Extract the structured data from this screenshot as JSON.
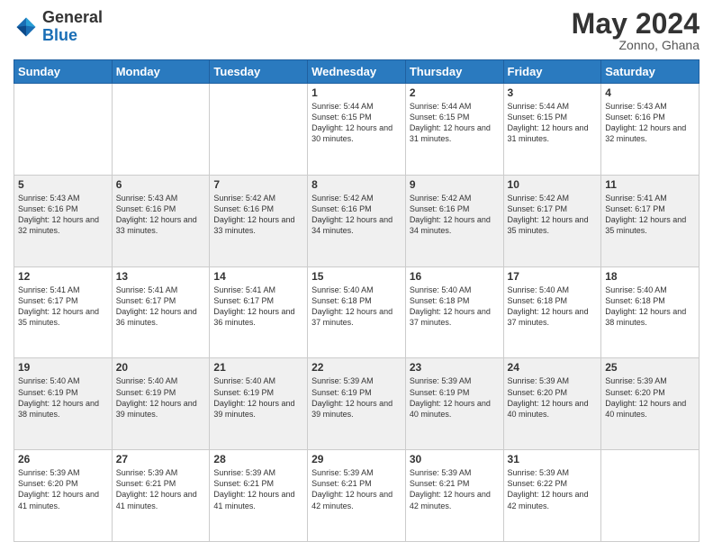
{
  "header": {
    "logo_line1": "General",
    "logo_line2": "Blue",
    "month_year": "May 2024",
    "location": "Zonno, Ghana"
  },
  "days_of_week": [
    "Sunday",
    "Monday",
    "Tuesday",
    "Wednesday",
    "Thursday",
    "Friday",
    "Saturday"
  ],
  "weeks": [
    [
      {
        "day": "",
        "info": ""
      },
      {
        "day": "",
        "info": ""
      },
      {
        "day": "",
        "info": ""
      },
      {
        "day": "1",
        "info": "Sunrise: 5:44 AM\nSunset: 6:15 PM\nDaylight: 12 hours\nand 30 minutes."
      },
      {
        "day": "2",
        "info": "Sunrise: 5:44 AM\nSunset: 6:15 PM\nDaylight: 12 hours\nand 31 minutes."
      },
      {
        "day": "3",
        "info": "Sunrise: 5:44 AM\nSunset: 6:15 PM\nDaylight: 12 hours\nand 31 minutes."
      },
      {
        "day": "4",
        "info": "Sunrise: 5:43 AM\nSunset: 6:16 PM\nDaylight: 12 hours\nand 32 minutes."
      }
    ],
    [
      {
        "day": "5",
        "info": "Sunrise: 5:43 AM\nSunset: 6:16 PM\nDaylight: 12 hours\nand 32 minutes."
      },
      {
        "day": "6",
        "info": "Sunrise: 5:43 AM\nSunset: 6:16 PM\nDaylight: 12 hours\nand 33 minutes."
      },
      {
        "day": "7",
        "info": "Sunrise: 5:42 AM\nSunset: 6:16 PM\nDaylight: 12 hours\nand 33 minutes."
      },
      {
        "day": "8",
        "info": "Sunrise: 5:42 AM\nSunset: 6:16 PM\nDaylight: 12 hours\nand 34 minutes."
      },
      {
        "day": "9",
        "info": "Sunrise: 5:42 AM\nSunset: 6:16 PM\nDaylight: 12 hours\nand 34 minutes."
      },
      {
        "day": "10",
        "info": "Sunrise: 5:42 AM\nSunset: 6:17 PM\nDaylight: 12 hours\nand 35 minutes."
      },
      {
        "day": "11",
        "info": "Sunrise: 5:41 AM\nSunset: 6:17 PM\nDaylight: 12 hours\nand 35 minutes."
      }
    ],
    [
      {
        "day": "12",
        "info": "Sunrise: 5:41 AM\nSunset: 6:17 PM\nDaylight: 12 hours\nand 35 minutes."
      },
      {
        "day": "13",
        "info": "Sunrise: 5:41 AM\nSunset: 6:17 PM\nDaylight: 12 hours\nand 36 minutes."
      },
      {
        "day": "14",
        "info": "Sunrise: 5:41 AM\nSunset: 6:17 PM\nDaylight: 12 hours\nand 36 minutes."
      },
      {
        "day": "15",
        "info": "Sunrise: 5:40 AM\nSunset: 6:18 PM\nDaylight: 12 hours\nand 37 minutes."
      },
      {
        "day": "16",
        "info": "Sunrise: 5:40 AM\nSunset: 6:18 PM\nDaylight: 12 hours\nand 37 minutes."
      },
      {
        "day": "17",
        "info": "Sunrise: 5:40 AM\nSunset: 6:18 PM\nDaylight: 12 hours\nand 37 minutes."
      },
      {
        "day": "18",
        "info": "Sunrise: 5:40 AM\nSunset: 6:18 PM\nDaylight: 12 hours\nand 38 minutes."
      }
    ],
    [
      {
        "day": "19",
        "info": "Sunrise: 5:40 AM\nSunset: 6:19 PM\nDaylight: 12 hours\nand 38 minutes."
      },
      {
        "day": "20",
        "info": "Sunrise: 5:40 AM\nSunset: 6:19 PM\nDaylight: 12 hours\nand 39 minutes."
      },
      {
        "day": "21",
        "info": "Sunrise: 5:40 AM\nSunset: 6:19 PM\nDaylight: 12 hours\nand 39 minutes."
      },
      {
        "day": "22",
        "info": "Sunrise: 5:39 AM\nSunset: 6:19 PM\nDaylight: 12 hours\nand 39 minutes."
      },
      {
        "day": "23",
        "info": "Sunrise: 5:39 AM\nSunset: 6:19 PM\nDaylight: 12 hours\nand 40 minutes."
      },
      {
        "day": "24",
        "info": "Sunrise: 5:39 AM\nSunset: 6:20 PM\nDaylight: 12 hours\nand 40 minutes."
      },
      {
        "day": "25",
        "info": "Sunrise: 5:39 AM\nSunset: 6:20 PM\nDaylight: 12 hours\nand 40 minutes."
      }
    ],
    [
      {
        "day": "26",
        "info": "Sunrise: 5:39 AM\nSunset: 6:20 PM\nDaylight: 12 hours\nand 41 minutes."
      },
      {
        "day": "27",
        "info": "Sunrise: 5:39 AM\nSunset: 6:21 PM\nDaylight: 12 hours\nand 41 minutes."
      },
      {
        "day": "28",
        "info": "Sunrise: 5:39 AM\nSunset: 6:21 PM\nDaylight: 12 hours\nand 41 minutes."
      },
      {
        "day": "29",
        "info": "Sunrise: 5:39 AM\nSunset: 6:21 PM\nDaylight: 12 hours\nand 42 minutes."
      },
      {
        "day": "30",
        "info": "Sunrise: 5:39 AM\nSunset: 6:21 PM\nDaylight: 12 hours\nand 42 minutes."
      },
      {
        "day": "31",
        "info": "Sunrise: 5:39 AM\nSunset: 6:22 PM\nDaylight: 12 hours\nand 42 minutes."
      },
      {
        "day": "",
        "info": ""
      }
    ]
  ]
}
